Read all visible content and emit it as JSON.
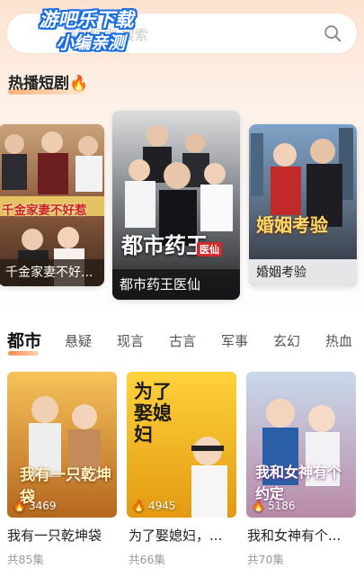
{
  "search": {
    "placeholder": "海量短剧 搜索",
    "watermark_line1": "游吧乐下载",
    "watermark_line2": "小编亲测"
  },
  "hot_section": {
    "title": "热播短剧",
    "icon": "fire-icon"
  },
  "hot_cards": [
    {
      "title": "千金家妻不好...",
      "poster_text": "千金家妻不好惹"
    },
    {
      "title": "都市药王医仙",
      "poster_text": "都市药王",
      "poster_badge": "医仙"
    },
    {
      "title": "婚姻考验",
      "poster_text": "婚姻考验"
    }
  ],
  "tabs": [
    "都市",
    "悬疑",
    "现言",
    "古言",
    "军事",
    "玄幻",
    "热血"
  ],
  "active_tab": "都市",
  "grid": [
    {
      "title": "我有一只乾坤袋",
      "display_title": "我有一只乾坤袋",
      "views": "3469",
      "episodes": "共85集",
      "poster_text": "我有一只乾坤袋"
    },
    {
      "title": "为了娶媳妇，...",
      "display_title": "为了娶媳妇，...",
      "views": "4945",
      "episodes": "共66集",
      "poster_text": "为了娶媳妇"
    },
    {
      "title": "我和女神有个...",
      "display_title": "我和女神有个...",
      "views": "5186",
      "episodes": "共70集",
      "poster_text": "我和女神有个约定"
    }
  ],
  "colors": {
    "accent": "#ff6a2a",
    "tab_underline": "#ff8a4c"
  }
}
